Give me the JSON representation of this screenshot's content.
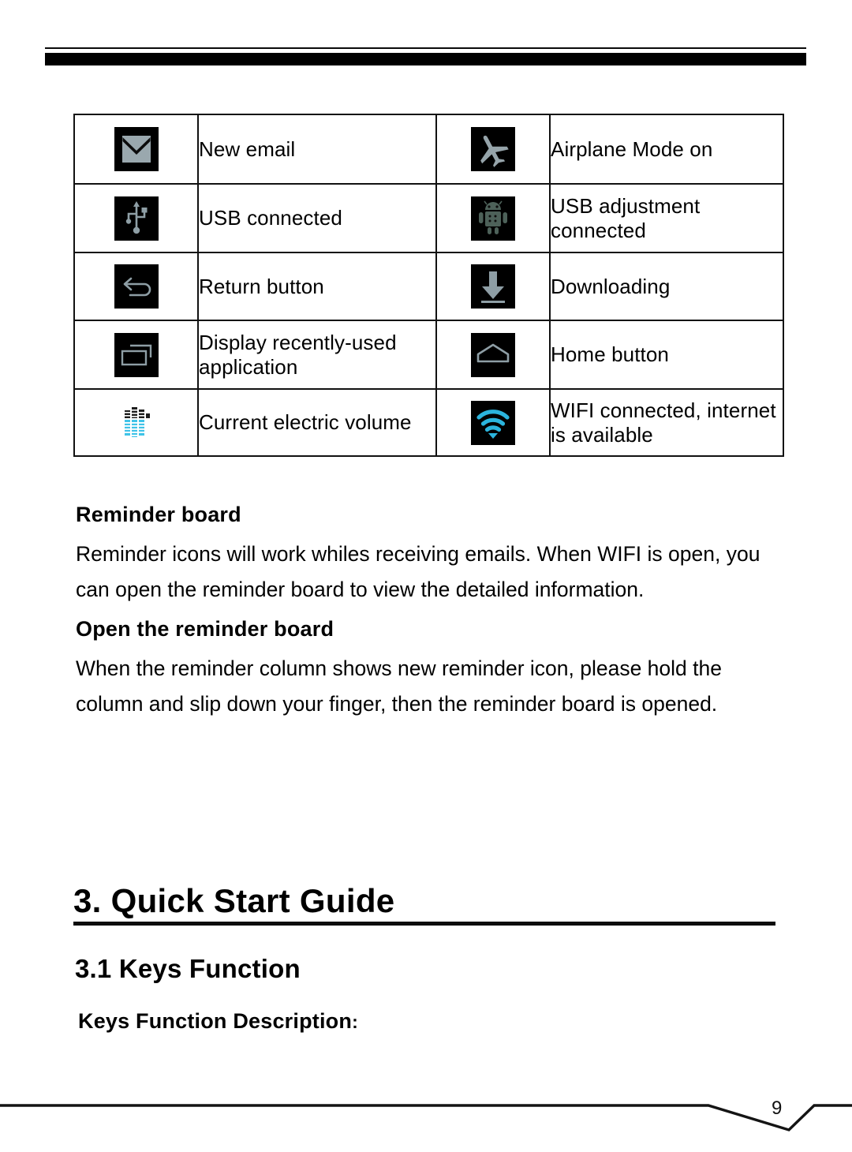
{
  "header": {
    "rule_top": "thin-rule",
    "rule_bottom": "thick-bar"
  },
  "icon_table": {
    "rows": [
      {
        "left": {
          "icon": "email-icon",
          "label": "New email"
        },
        "right": {
          "icon": "airplane-icon",
          "label": "Airplane Mode on"
        }
      },
      {
        "left": {
          "icon": "usb-icon",
          "label": "USB connected"
        },
        "right": {
          "icon": "android-debug-icon",
          "label": "USB adjustment connected"
        }
      },
      {
        "left": {
          "icon": "return-arrow-icon",
          "label": "Return button"
        },
        "right": {
          "icon": "download-icon",
          "label": "Downloading"
        }
      },
      {
        "left": {
          "icon": "recent-apps-icon",
          "label": "Display recently-used application"
        },
        "right": {
          "icon": "home-icon",
          "label": "Home button"
        }
      },
      {
        "left": {
          "icon": "battery-level-icon",
          "label": "Current electric volume"
        },
        "right": {
          "icon": "wifi-icon",
          "label": "WIFI connected, internet is available"
        }
      }
    ]
  },
  "sections": {
    "reminder_board": {
      "heading": "Reminder board",
      "text": "Reminder icons will work whiles receiving emails. When WIFI is open, you can open the reminder board to view the detailed information."
    },
    "open_reminder_board": {
      "heading": "Open the reminder board",
      "text": "When the reminder column shows new reminder icon, please hold the column and slip down your finger, then the reminder board is opened."
    }
  },
  "chapter": {
    "title": "3. Quick Start Guide",
    "subsection": "3.1 Keys Function",
    "keys_description": "Keys Function Description",
    "keys_description_colon": ":"
  },
  "footer": {
    "page_number": "9"
  },
  "colors": {
    "icon_background": "#000000",
    "icon_glyph_gray": "#8a9aa0",
    "icon_glyph_cyan": "#27b6e0",
    "android_green": "#4a5f54",
    "rule": "#0d0d0d",
    "text": "#000000"
  }
}
